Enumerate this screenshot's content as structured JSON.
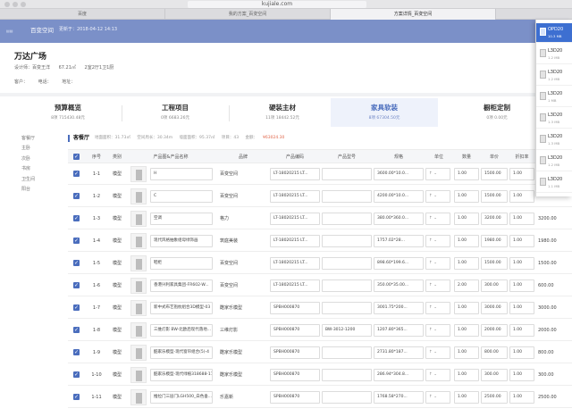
{
  "browser": {
    "url": "kujiale.com",
    "tabs": [
      "百度",
      "我的方案_百变空间",
      "方案详情_百变空间"
    ]
  },
  "app": {
    "name": "百变空间",
    "updated": "更新于：2018-04-12 14:13"
  },
  "project": {
    "title": "万达广场",
    "designer": "设计师：百变王洋",
    "area": "67.21㎡",
    "layout": "2室2厅1卫1厨",
    "client_label": "客户：",
    "phone_label": "电话：",
    "address_label": "地址："
  },
  "categories": [
    {
      "name": "预算概览",
      "count": "8项",
      "amount": "715430.48元"
    },
    {
      "name": "工程项目",
      "count": "0项",
      "amount": "6683.26元"
    },
    {
      "name": "硬装主材",
      "count": "11项",
      "amount": "18442.52元"
    },
    {
      "name": "家具软装",
      "count": "8项",
      "amount": "67304.50元"
    },
    {
      "name": "橱柜定制",
      "count": "0项",
      "amount": "0.00元"
    }
  ],
  "side_nav": [
    "客餐厅",
    "主卧",
    "次卧",
    "书房",
    "卫生间",
    "阳台"
  ],
  "room": {
    "name": "客餐厅",
    "stats": [
      "地面面积：31.73㎡",
      "空间周长：30.34m",
      "墙面面积：95.37㎡",
      "项目：43",
      "金额："
    ],
    "amount": "¥63024.30"
  },
  "columns": [
    "序号",
    "类别",
    "产品图&产品名称",
    "品牌",
    "产品编码",
    "产品型号",
    "规格",
    "单位",
    "数量",
    "单价",
    "折扣率"
  ],
  "rows": [
    {
      "no": "1-1",
      "cat": "模型",
      "name": "H",
      "brand": "百变空间",
      "code": "LT-18020215 LT...",
      "model": "",
      "spec": "3600.00*10.0...",
      "qty": "1.00",
      "price": "1500.00",
      "disc": "1.00",
      "total": ""
    },
    {
      "no": "1-2",
      "cat": "模型",
      "name": "C",
      "brand": "百变空间",
      "code": "LT-18020215 LT...",
      "model": "",
      "spec": "4200.00*10.0...",
      "qty": "1.00",
      "price": "1500.00",
      "disc": "1.00",
      "total": ""
    },
    {
      "no": "1-3",
      "cat": "模型",
      "name": "空调",
      "brand": "格力",
      "code": "LT-18020215 LT...",
      "model": "",
      "spec": "380.00*360.0...",
      "qty": "1.00",
      "price": "3200.00",
      "disc": "1.00",
      "total": "3200.00"
    },
    {
      "no": "1-4",
      "cat": "模型",
      "name": "现代风格抽象组母绿饰画",
      "brand": "筑庭美装",
      "code": "LT-18020215 LT...",
      "model": "",
      "spec": "1757.02*28...",
      "qty": "1.00",
      "price": "1980.00",
      "disc": "1.00",
      "total": "1980.00"
    },
    {
      "no": "1-5",
      "cat": "模型",
      "name": "鞋柜",
      "brand": "百变空间",
      "code": "LT-18020215 LT...",
      "model": "",
      "spec": "898.60*199.6...",
      "qty": "1.00",
      "price": "1500.00",
      "disc": "1.00",
      "total": "1500.00"
    },
    {
      "no": "1-6",
      "cat": "模型",
      "name": "香港兴利家具集团-FR602-W...",
      "brand": "百变空间",
      "code": "LT-18020215 LT...",
      "model": "",
      "spec": "350.00*35.00...",
      "qty": "2.00",
      "price": "300.00",
      "disc": "1.00",
      "total": "600.00"
    },
    {
      "no": "1-7",
      "cat": "模型",
      "name": "新中式布艺抱枕组合3D模型-03",
      "brand": "酷家乐模型",
      "code": "SPBH000870",
      "model": "",
      "spec": "3001.75*200...",
      "qty": "1.00",
      "price": "3000.00",
      "disc": "1.00",
      "total": "3000.00"
    },
    {
      "no": "1-8",
      "cat": "模型",
      "name": "三维灯影 BW-北欧后现代落地...",
      "brand": "三维灯影",
      "code": "SPBH000870",
      "model": "BW-3012-1200",
      "spec": "1207.80*365...",
      "qty": "1.00",
      "price": "2000.00",
      "disc": "1.00",
      "total": "2000.00"
    },
    {
      "no": "1-9",
      "cat": "模型",
      "name": "酷家乐模型-现代窗帘组合(5)-4",
      "brand": "酷家乐模型",
      "code": "SPBH000870",
      "model": "",
      "spec": "2731.80*187...",
      "qty": "1.00",
      "price": "800.00",
      "disc": "1.00",
      "total": "800.00"
    },
    {
      "no": "1-10",
      "cat": "模型",
      "name": "酷家乐模型-现代绿植318688-11",
      "brand": "酷家乐模型",
      "code": "SPBH000870",
      "model": "",
      "spec": "286.94*304.8...",
      "qty": "1.00",
      "price": "300.00",
      "disc": "1.00",
      "total": "300.00"
    },
    {
      "no": "1-11",
      "cat": "模型",
      "name": "推拉门三层门LGH500_白色垂...",
      "brand": "乐嘉新",
      "code": "SPBH000870",
      "model": "",
      "spec": "1768.58*270...",
      "qty": "1.00",
      "price": "2500.00",
      "disc": "1.00",
      "total": "2500.00"
    }
  ],
  "downloads": [
    {
      "name": "OPD20",
      "size": "10.3 MB"
    },
    {
      "name": "L3D20",
      "size": "1.2 MB"
    },
    {
      "name": "L3D20",
      "size": "1.2 MB"
    },
    {
      "name": "L3D20",
      "size": "1 MB"
    },
    {
      "name": "L3D20",
      "size": "1.3 MB"
    },
    {
      "name": "L3D20",
      "size": "1.3 MB"
    },
    {
      "name": "L3D20",
      "size": "1.2 MB"
    },
    {
      "name": "L3D20",
      "size": "1.1 MB"
    }
  ]
}
